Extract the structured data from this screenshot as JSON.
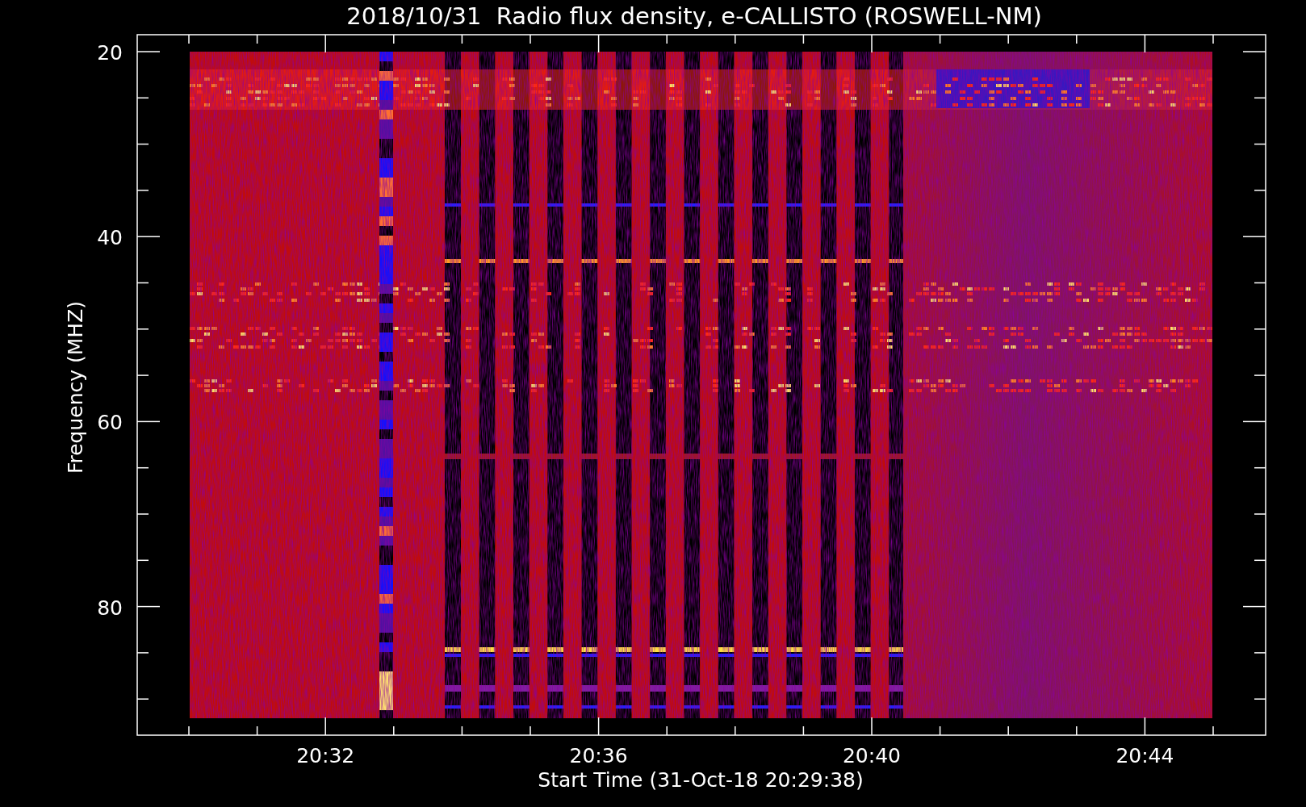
{
  "plot": {
    "title": "2018/10/31  Radio flux density, e-CALLISTO (ROSWELL-NM)",
    "ylabel": "Frequency (MHZ)",
    "xlabel": "Start Time (31-Oct-18 20:29:38)",
    "y_tick_labels": [
      "20",
      "40",
      "60",
      "80"
    ],
    "x_tick_labels": [
      "20:32",
      "20:36",
      "20:40",
      "20:44"
    ]
  }
}
